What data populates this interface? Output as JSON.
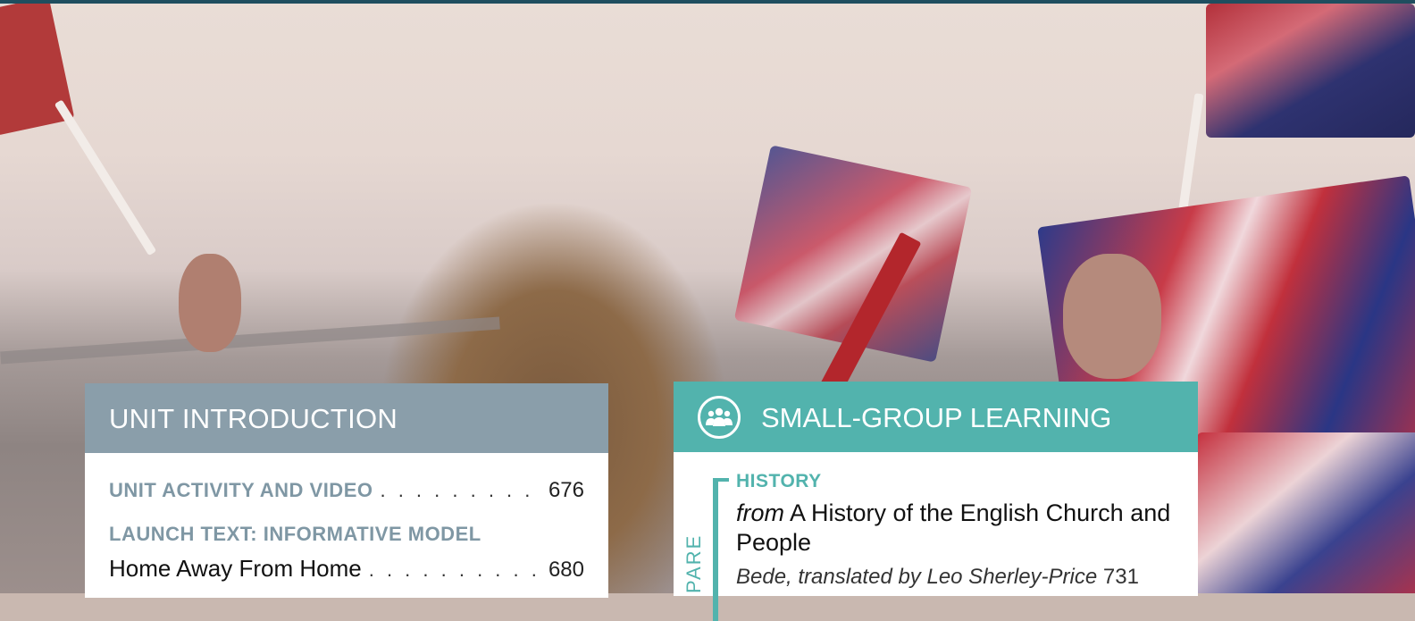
{
  "colors": {
    "unit_header": "#8a9eaa",
    "unit_category": "#7f97a4",
    "sgl_header": "#52b3ad",
    "top_bar": "#1f4e5f"
  },
  "unit_intro": {
    "header": "UNIT INTRODUCTION",
    "rows": [
      {
        "category": "UNIT ACTIVITY AND VIDEO",
        "page": "676"
      },
      {
        "category": "LAUNCH TEXT: INFORMATIVE MODEL",
        "title": "Home Away From Home",
        "page": "680"
      }
    ]
  },
  "small_group": {
    "icon": "group-icon",
    "header": "SMALL-GROUP LEARNING",
    "side_label": "PARE",
    "entry": {
      "category": "HISTORY",
      "title_prefix": "from",
      "title": "A History of the English Church and People",
      "author": "Bede, translated by Leo Sherley-Price",
      "page": "731"
    }
  }
}
